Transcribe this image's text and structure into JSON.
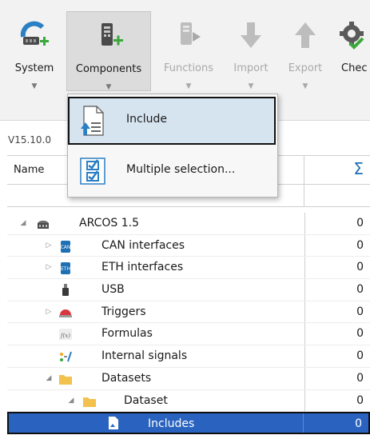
{
  "ribbon": {
    "buttons": [
      {
        "label": "System",
        "icon": "system-icon",
        "has_dropdown": true,
        "enabled": true
      },
      {
        "label": "Components",
        "icon": "components-icon",
        "has_dropdown": true,
        "enabled": true,
        "pressed": true
      },
      {
        "label": "Functions",
        "icon": "functions-icon",
        "has_dropdown": true,
        "enabled": false
      },
      {
        "label": "Import",
        "icon": "import-icon",
        "has_dropdown": true,
        "enabled": false
      },
      {
        "label": "Export",
        "icon": "export-icon",
        "has_dropdown": true,
        "enabled": false
      },
      {
        "label": "Chec",
        "icon": "check-icon",
        "has_dropdown": false,
        "enabled": true
      }
    ]
  },
  "menu": {
    "items": [
      {
        "label": "Include",
        "icon": "include-icon",
        "highlighted": true
      },
      {
        "label": "Multiple selection...",
        "icon": "multiple-selection-icon",
        "highlighted": false
      }
    ]
  },
  "grid": {
    "version": "V15.10.0",
    "columns": {
      "name": "Name",
      "sum": "Σ"
    },
    "rows": [
      {
        "label": "ARCOS 1.5",
        "count": "0",
        "icon": "device-icon",
        "expander": "expanded"
      },
      {
        "label": "CAN interfaces",
        "count": "0",
        "icon": "can-icon",
        "expander": "collapsed"
      },
      {
        "label": "ETH interfaces",
        "count": "0",
        "icon": "eth-icon",
        "expander": "collapsed"
      },
      {
        "label": "USB",
        "count": "0",
        "icon": "usb-icon",
        "expander": "none"
      },
      {
        "label": "Triggers",
        "count": "0",
        "icon": "trigger-icon",
        "expander": "collapsed"
      },
      {
        "label": "Formulas",
        "count": "0",
        "icon": "formula-icon",
        "expander": "none"
      },
      {
        "label": "Internal signals",
        "count": "0",
        "icon": "internal-signals-icon",
        "expander": "none"
      },
      {
        "label": "Datasets",
        "count": "0",
        "icon": "folder-icon",
        "expander": "expanded"
      },
      {
        "label": "Dataset",
        "count": "0",
        "icon": "folder-icon",
        "expander": "expanded"
      },
      {
        "label": "Includes",
        "count": "0",
        "icon": "includes-icon",
        "expander": "none",
        "selected": true
      }
    ]
  },
  "colors": {
    "accent": "#2a63bf",
    "sigma": "#1f6fb3",
    "folder": "#f2c14e",
    "trigger": "#d9363e",
    "add": "#3aa83a"
  }
}
